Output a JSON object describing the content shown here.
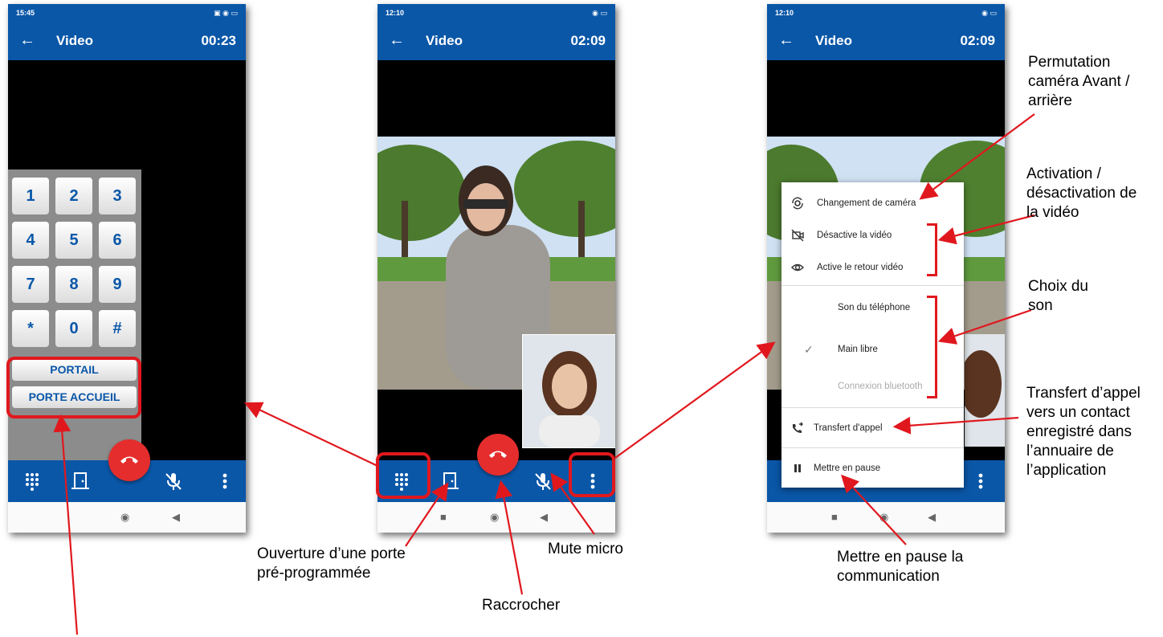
{
  "phone1": {
    "status_time": "15:45",
    "title": "Video",
    "timer": "00:23",
    "keys": [
      "1",
      "2",
      "3",
      "4",
      "5",
      "6",
      "7",
      "8",
      "9",
      "*",
      "0",
      "#"
    ],
    "door_buttons": [
      "PORTAIL",
      "PORTE ACCUEIL"
    ]
  },
  "phone2": {
    "status_time": "12:10",
    "title": "Video",
    "timer": "02:09"
  },
  "phone3": {
    "status_time": "12:10",
    "title": "Video",
    "timer": "02:09",
    "menu": {
      "switch_camera": "Changement de caméra",
      "disable_video": "Désactive la vidéo",
      "enable_return_video": "Active le retour vidéo",
      "phone_sound": "Son du téléphone",
      "speaker": "Main libre",
      "bluetooth": "Connexion bluetooth",
      "transfer": "Transfert d'appel",
      "pause": "Mettre en pause"
    }
  },
  "annotations": {
    "camera_switch": "Permutation caméra Avant / arrière",
    "video_toggle": "Activation / désactivation de la vidéo",
    "sound_choice": "Choix du son",
    "transfer": "Transfert d’appel vers un contact enregistré dans l’annuaire de l’application",
    "pause": "Mettre en pause la communication",
    "open_door": "Ouverture d’une porte pré-programmée",
    "mute": "Mute micro",
    "hangup": "Raccrocher"
  },
  "colors": {
    "app_blue": "#0a57a8",
    "hangup_red": "#e52d2d",
    "callout_red": "#e0181e"
  }
}
